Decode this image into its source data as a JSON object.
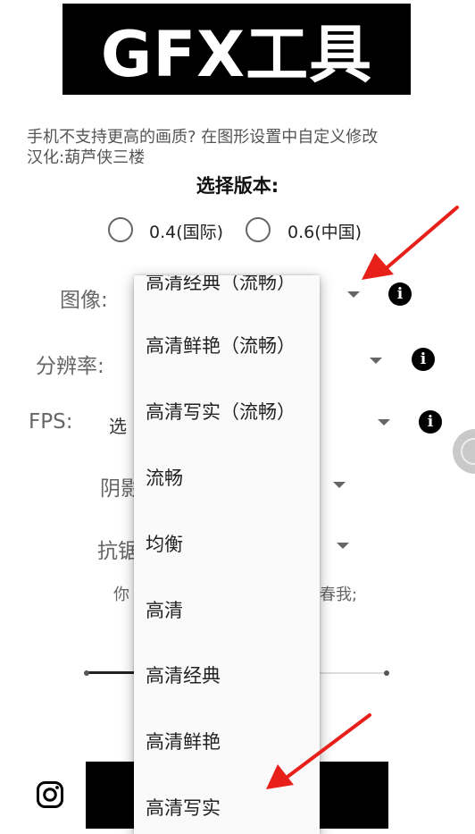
{
  "banner": {
    "title": "GFX工具"
  },
  "hint": {
    "line1": "手机不支持更高的画质? 在图形设置中自定义修改",
    "line2": "汉化:葫芦侠三楼"
  },
  "version": {
    "title": "选择版本:",
    "options": [
      {
        "label": "0.4(国际)",
        "selected": false
      },
      {
        "label": "0.6(中国)",
        "selected": false
      }
    ]
  },
  "settings": {
    "graphics": {
      "label": "图像:"
    },
    "resolution": {
      "label": "分辨率:"
    },
    "fps": {
      "label": "FPS:",
      "value_partial": "选"
    },
    "shadow": {
      "label_partial": "阴影"
    },
    "antialias": {
      "label_partial": "抗锯"
    }
  },
  "note_partial": {
    "left": "你",
    "right": "春我;"
  },
  "dropdown": {
    "options": [
      "高清经典（流畅）",
      "高清鲜艳（流畅）",
      "高清写实（流畅）",
      "流畅",
      "均衡",
      "高清",
      "高清经典",
      "高清鲜艳",
      "高清写实"
    ]
  },
  "icons": {
    "info": "info-icon",
    "instagram": "instagram-icon",
    "float": "floating-action-icon",
    "arrow_color": "#e8201a"
  }
}
